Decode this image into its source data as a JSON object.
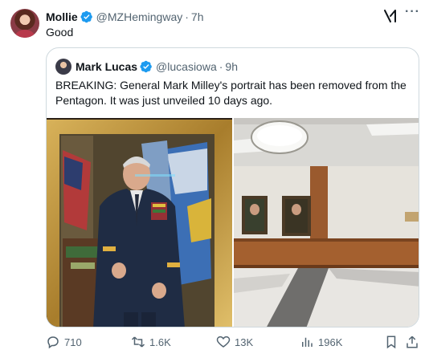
{
  "tweet": {
    "author_name": "Mollie",
    "author_handle": "@MZHemingway",
    "time": "7h",
    "text": "Good"
  },
  "quote": {
    "author_name": "Mark Lucas",
    "author_handle": "@lucasiowa",
    "time": "9h",
    "text": "BREAKING: General Mark Milley's portrait has been removed from the Pentagon. It was just unveiled 10 days ago."
  },
  "actions": {
    "replies": "710",
    "reposts": "1.6K",
    "likes": "13K",
    "views": "196K"
  },
  "colors": {
    "verified": "#1d9bf0",
    "secondary_text": "#536471",
    "border": "#cfd9de"
  },
  "icons": [
    "verified-badge-icon",
    "grok-icon",
    "more-icon",
    "reply-icon",
    "repost-icon",
    "like-icon",
    "views-icon",
    "bookmark-icon",
    "share-icon"
  ]
}
